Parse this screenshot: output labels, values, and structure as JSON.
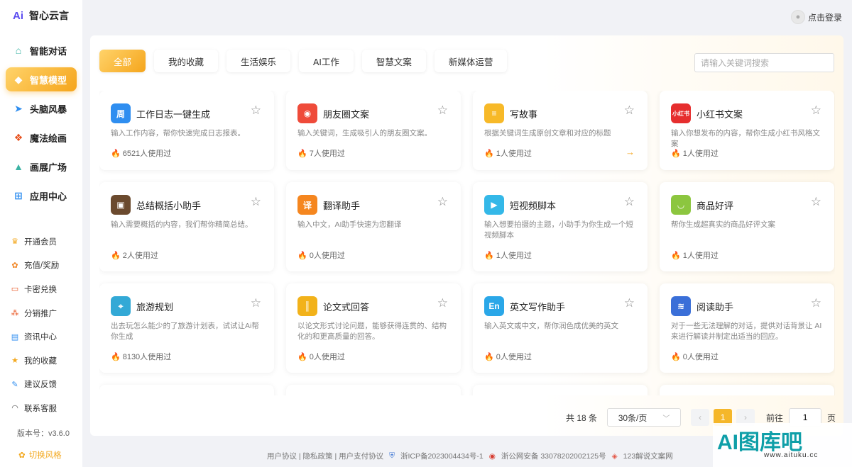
{
  "brand": {
    "mark": "Ai",
    "name": "智心云言"
  },
  "header": {
    "login_label": "点击登录"
  },
  "nav": [
    {
      "label": "智能对话",
      "icon": "home-icon",
      "active": false
    },
    {
      "label": "智慧模型",
      "icon": "cube-icon",
      "active": true
    },
    {
      "label": "头脑风暴",
      "icon": "paper-plane-icon",
      "active": false
    },
    {
      "label": "魔法绘画",
      "icon": "palette-icon",
      "active": false
    },
    {
      "label": "画展广场",
      "icon": "picture-icon",
      "active": false
    },
    {
      "label": "应用中心",
      "icon": "apps-icon",
      "active": false
    }
  ],
  "sub_nav": [
    {
      "label": "开通会员",
      "icon": "vip-icon"
    },
    {
      "label": "充值/奖励",
      "icon": "gift-icon"
    },
    {
      "label": "卡密兑换",
      "icon": "card-icon"
    },
    {
      "label": "分销推广",
      "icon": "share-icon"
    },
    {
      "label": "资讯中心",
      "icon": "news-icon"
    },
    {
      "label": "我的收藏",
      "icon": "star-icon"
    },
    {
      "label": "建议反馈",
      "icon": "feedback-icon"
    },
    {
      "label": "联系客服",
      "icon": "headset-icon"
    }
  ],
  "version": "版本号：v3.6.0",
  "theme_label": "切换风格",
  "tabs": [
    "全部",
    "我的收藏",
    "生活娱乐",
    "AI工作",
    "智慧文案",
    "新媒体运营"
  ],
  "search": {
    "placeholder": "请输入关键词搜索"
  },
  "cards": [
    {
      "title": "工作日志一键生成",
      "desc": "输入工作内容，帮你快速完成日志报表。",
      "used": "6521人使用过",
      "icon": "journal-icon",
      "color": "#2f8ef0",
      "glyph": "周"
    },
    {
      "title": "朋友圈文案",
      "desc": "输入关键词，生成吸引人的朋友圈文案。",
      "used": "7人使用过",
      "icon": "aperture-icon",
      "color": "#ef4b3a",
      "glyph": "◉"
    },
    {
      "title": "写故事",
      "desc": "根据关键词生成原创文章和对应的标题",
      "used": "1人使用过",
      "icon": "notebook-icon",
      "color": "#f7b928",
      "glyph": "≡"
    },
    {
      "title": "小红书文案",
      "desc": "输入你想发布的内容，帮你生成小红书风格文案",
      "used": "1人使用过",
      "icon": "xiaohongshu-icon",
      "color": "#e62e2e",
      "glyph": "小红书"
    },
    {
      "title": "总结概括小助手",
      "desc": "输入需要概括的内容，我们帮你精简总结。",
      "used": "2人使用过",
      "icon": "briefcase-icon",
      "color": "#6b4a2e",
      "glyph": "▣"
    },
    {
      "title": "翻译助手",
      "desc": "输入中文，AI助手快速为您翻译",
      "used": "0人使用过",
      "icon": "translate-icon",
      "color": "#f5861f",
      "glyph": "译"
    },
    {
      "title": "短视频脚本",
      "desc": "输入想要拍摄的主题，小助手为你生成一个短视频脚本",
      "used": "1人使用过",
      "icon": "clapper-icon",
      "color": "#34b8e8",
      "glyph": "▶"
    },
    {
      "title": "商品好评",
      "desc": "帮你生成超真实的商品好评文案",
      "used": "1人使用过",
      "icon": "shopping-bag-icon",
      "color": "#8cc63f",
      "glyph": "◡"
    },
    {
      "title": "旅游规划",
      "desc": "出去玩怎么能少的了旅游计划表，试试让Ai帮你生成",
      "used": "8130人使用过",
      "icon": "travel-icon",
      "color": "#33a9d6",
      "glyph": "⌖"
    },
    {
      "title": "论文式回答",
      "desc": "以论文形式讨论问题，能够获得连贯的、结构化的和更高质量的回答。",
      "used": "0人使用过",
      "icon": "binders-icon",
      "color": "#f2b21a",
      "glyph": "║"
    },
    {
      "title": "英文写作助手",
      "desc": "输入英文或中文，帮你润色成优美的英文",
      "used": "0人使用过",
      "icon": "english-icon",
      "color": "#2aa7e8",
      "glyph": "En"
    },
    {
      "title": "阅读助手",
      "desc": "对于一些无法理解的对话，提供对话背景让 AI 来进行解读并制定出适当的回应。",
      "used": "0人使用过",
      "icon": "books-icon",
      "color": "#3a6fd8",
      "glyph": "≋"
    }
  ],
  "pager": {
    "total": "共 18 条",
    "page_size": "30条/页",
    "current": "1",
    "goto_label": "前往",
    "goto_value": "1",
    "page_suffix": "页"
  },
  "footer": {
    "links": "用户协议 | 隐私政策 | 用户支付协议",
    "icp": "浙ICP备2023004434号-1",
    "police": "浙公网安备 33078202002125号",
    "extra": "123解说文案网"
  },
  "watermark": {
    "big": "AI图库吧",
    "small": "www.aituku.cc"
  }
}
